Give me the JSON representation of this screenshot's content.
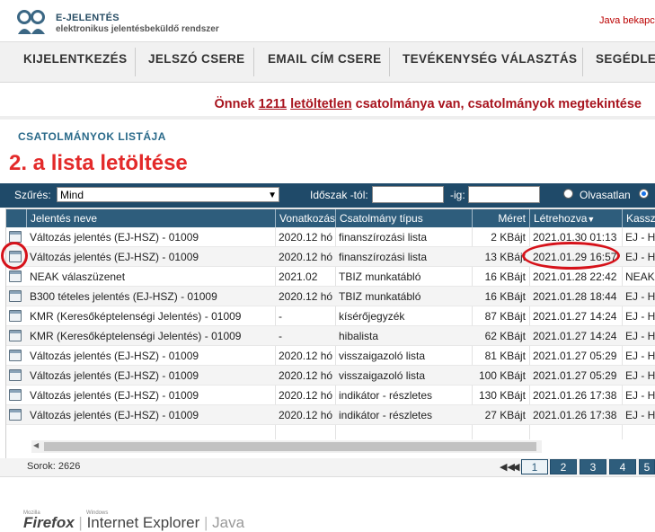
{
  "header": {
    "brand_title": "E-JELENTÉS",
    "brand_subtitle": "elektronikus jelentésbeküldő rendszer",
    "java_link": "Java bekapcs"
  },
  "nav": {
    "items": [
      "KIJELENTKEZÉS",
      "JELSZÓ CSERE",
      "EMAIL CÍM CSERE",
      "TEVÉKENYSÉG VÁLASZTÁS",
      "SEGÉDLET"
    ]
  },
  "notice": {
    "prefix": "Önnek ",
    "count": "1211",
    "link": "letöltetlen",
    "suffix": " csatolmánya van, csatolmányok megtekintése"
  },
  "section_title": "CSATOLMÁNYOK LISTÁJA",
  "annotation": {
    "title": "2. a lista letöltése"
  },
  "filter": {
    "label": "Szűrés:",
    "selected": "Mind",
    "period_label": "Időszak -tól:",
    "to_label": "-ig:",
    "from_value": "",
    "to_value": "",
    "radio_unread": "Olvasatlan"
  },
  "table": {
    "headers": [
      "Jelentés neve",
      "Vonatkozás",
      "Csatolmány típus",
      "Méret",
      "Létrehozva",
      "Kassza"
    ],
    "rows": [
      {
        "name": "Változás jelentés (EJ-HSZ) - 01009",
        "ref": "2020.12 hó",
        "type": "finanszírozási lista",
        "size": "2 KBájt",
        "created": "2021.01.30 01:13",
        "kassza": "EJ - H"
      },
      {
        "name": "Változás jelentés (EJ-HSZ) - 01009",
        "ref": "2020.12 hó",
        "type": "finanszírozási lista",
        "size": "13 KBájt",
        "created": "2021.01.29 16:57",
        "kassza": "EJ - H"
      },
      {
        "name": "NEAK válaszüzenet",
        "ref": "2021.02",
        "type": "TBIZ munkatábló",
        "size": "16 KBájt",
        "created": "2021.01.28 22:42",
        "kassza": "NEAK"
      },
      {
        "name": "B300 tételes jelentés (EJ-HSZ) - 01009",
        "ref": "2020.12 hó",
        "type": "TBIZ munkatábló",
        "size": "16 KBájt",
        "created": "2021.01.28 18:44",
        "kassza": "EJ - H"
      },
      {
        "name": "KMR (Keresőképtelenségi Jelentés) - 01009",
        "ref": "-",
        "type": "kísérőjegyzék",
        "size": "87 KBájt",
        "created": "2021.01.27 14:24",
        "kassza": "EJ - H"
      },
      {
        "name": "KMR (Keresőképtelenségi Jelentés) - 01009",
        "ref": "-",
        "type": "hibalista",
        "size": "62 KBájt",
        "created": "2021.01.27 14:24",
        "kassza": "EJ - H"
      },
      {
        "name": "Változás jelentés (EJ-HSZ) - 01009",
        "ref": "2020.12 hó",
        "type": "visszaigazoló lista",
        "size": "81 KBájt",
        "created": "2021.01.27 05:29",
        "kassza": "EJ - H"
      },
      {
        "name": "Változás jelentés (EJ-HSZ) - 01009",
        "ref": "2020.12 hó",
        "type": "visszaigazoló lista",
        "size": "100 KBájt",
        "created": "2021.01.27 05:29",
        "kassza": "EJ - H"
      },
      {
        "name": "Változás jelentés (EJ-HSZ) - 01009",
        "ref": "2020.12 hó",
        "type": "indikátor - részletes",
        "size": "130 KBájt",
        "created": "2021.01.26 17:38",
        "kassza": "EJ - H"
      },
      {
        "name": "Változás jelentés (EJ-HSZ) - 01009",
        "ref": "2020.12 hó",
        "type": "indikátor - részletes",
        "size": "27 KBájt",
        "created": "2021.01.26 17:38",
        "kassza": "EJ - H"
      }
    ]
  },
  "pager": {
    "rows_label": "Sorok: 2626",
    "pages": [
      "1",
      "2",
      "3",
      "4",
      "5"
    ],
    "current": "1"
  },
  "footer": {
    "firefox_small": "Mozilla",
    "firefox": "Firefox",
    "ie_small": "Windows",
    "ie": "Internet Explorer",
    "java": "Java"
  },
  "colors": {
    "header_blue": "#2e5d7c",
    "filter_blue": "#1f4a69",
    "notice_red": "#a8141e",
    "annotation_red": "#e32a2a"
  }
}
